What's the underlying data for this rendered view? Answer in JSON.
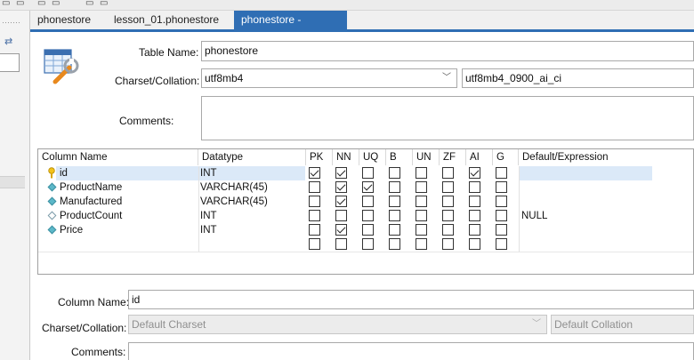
{
  "tabs": [
    {
      "label": "phonestore",
      "active": false
    },
    {
      "label": "lesson_01.phonestore",
      "active": false
    },
    {
      "label": "phonestore - Table",
      "active": true,
      "close": "×"
    }
  ],
  "form": {
    "table_name_label": "Table Name:",
    "table_name_value": "phonestore",
    "charset_label": "Charset/Collation:",
    "charset_value": "utf8mb4",
    "collation_value": "utf8mb4_0900_ai_ci",
    "comments_label": "Comments:",
    "comments_value": ""
  },
  "columns_grid": {
    "headers": [
      "Column Name",
      "Datatype",
      "PK",
      "NN",
      "UQ",
      "B",
      "UN",
      "ZF",
      "AI",
      "G",
      "Default/Expression"
    ],
    "rows": [
      {
        "name": "id",
        "datatype": "INT",
        "icon": "primary-key-icon",
        "flags": [
          true,
          true,
          false,
          false,
          false,
          false,
          true,
          false
        ],
        "default": ""
      },
      {
        "name": "ProductName",
        "datatype": "VARCHAR(45)",
        "icon": "column-diamond-icon",
        "flags": [
          false,
          true,
          true,
          false,
          false,
          false,
          false,
          false
        ],
        "default": ""
      },
      {
        "name": "Manufactured",
        "datatype": "VARCHAR(45)",
        "icon": "column-diamond-icon",
        "flags": [
          false,
          true,
          false,
          false,
          false,
          false,
          false,
          false
        ],
        "default": ""
      },
      {
        "name": "ProductCount",
        "datatype": "INT",
        "icon": "column-diamond-open-icon",
        "flags": [
          false,
          false,
          false,
          false,
          false,
          false,
          false,
          false
        ],
        "default": "NULL"
      },
      {
        "name": "Price",
        "datatype": "INT",
        "icon": "column-diamond-icon",
        "flags": [
          false,
          true,
          false,
          false,
          false,
          false,
          false,
          false
        ],
        "default": ""
      },
      {
        "name": "",
        "datatype": "",
        "icon": "",
        "flags": [
          false,
          false,
          false,
          false,
          false,
          false,
          false,
          false
        ],
        "default": ""
      }
    ]
  },
  "column_details": {
    "column_name_label": "Column Name:",
    "column_name_value": "id",
    "charset_label": "Charset/Collation:",
    "charset_value": "Default Charset",
    "collation_value": "Default Collation",
    "comments_label": "Comments:"
  },
  "colors": {
    "accent": "#2f6eb4",
    "selected_row": "#dbe9f8"
  }
}
